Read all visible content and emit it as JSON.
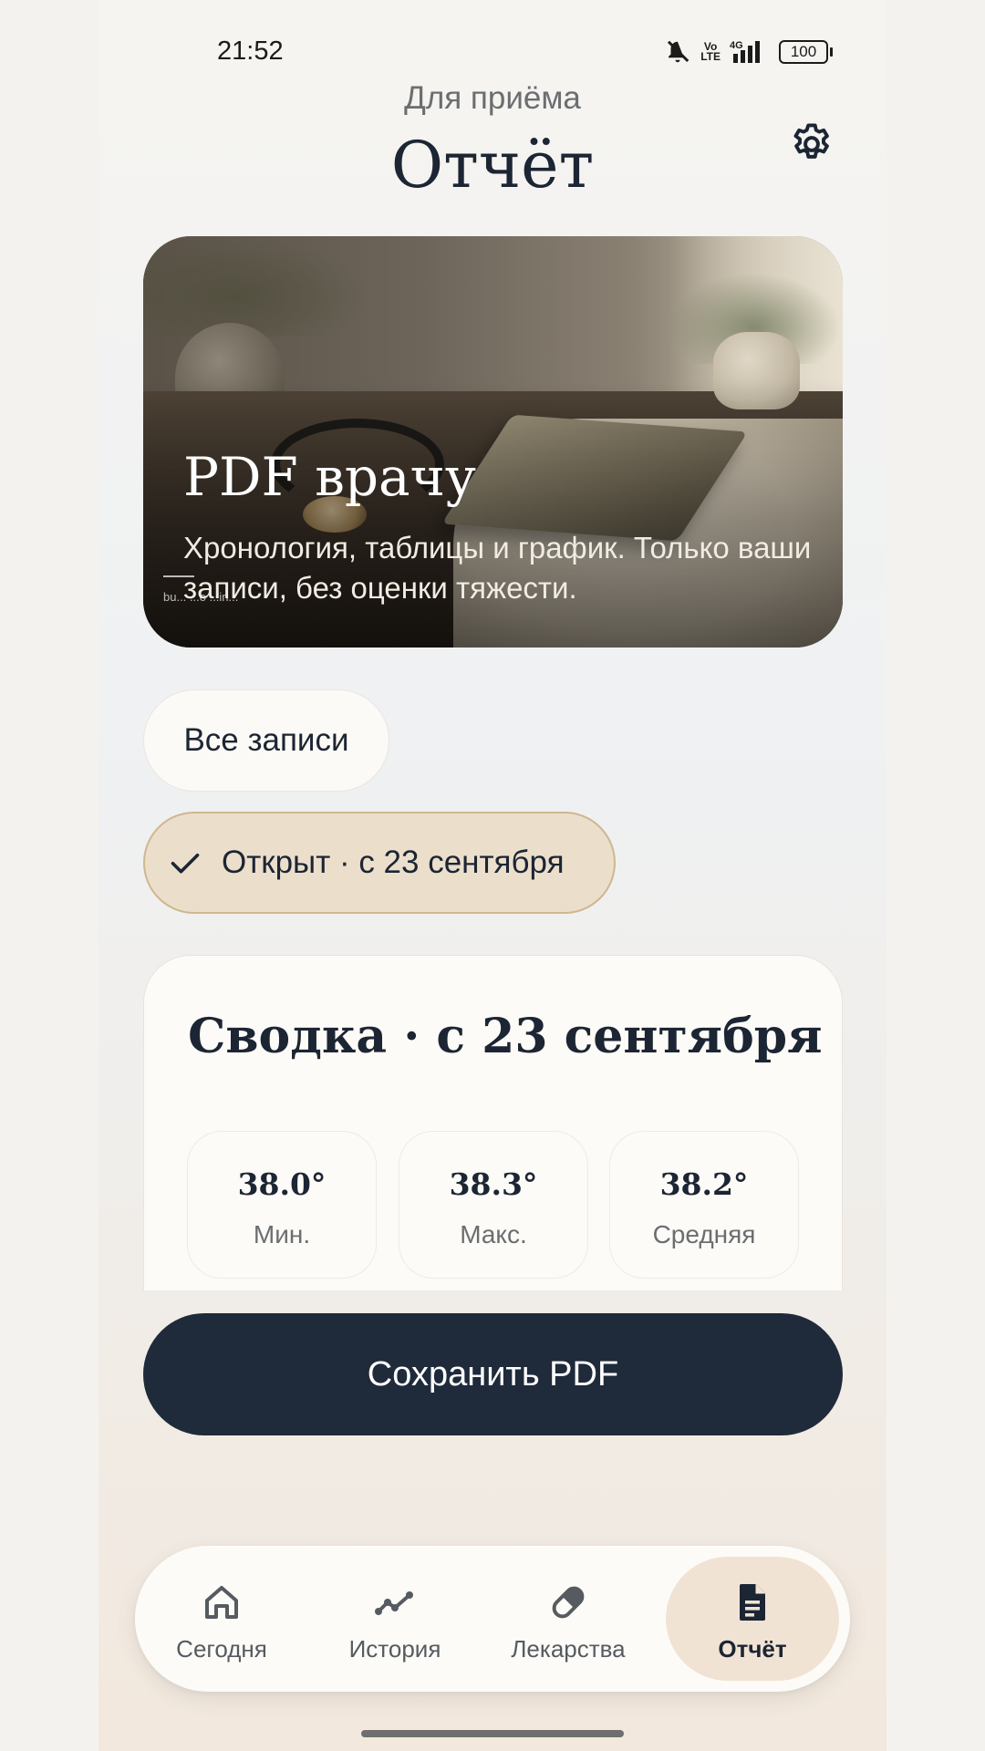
{
  "status_bar": {
    "time": "21:52",
    "volte": "Vo\nLTE",
    "network": "4G",
    "battery": "100"
  },
  "header": {
    "subtitle": "Для приёма",
    "title": "Отчёт"
  },
  "hero": {
    "title": "PDF врачу",
    "description": "Хронология, таблицы и график. Только ваши записи, без оценки тяжести.",
    "credit": "bu... ...o ...in..."
  },
  "filters": {
    "all_label": "Все записи",
    "selected_label": "Открыт · с 23 сентября"
  },
  "summary": {
    "title": "Сводка · с 23 сентября",
    "stats": [
      {
        "value": "38.0°",
        "label": "Мин."
      },
      {
        "value": "38.3°",
        "label": "Макс."
      },
      {
        "value": "38.2°",
        "label": "Средняя"
      }
    ]
  },
  "actions": {
    "save_label": "Сохранить PDF"
  },
  "nav": {
    "items": [
      {
        "label": "Сегодня",
        "icon": "home-icon"
      },
      {
        "label": "История",
        "icon": "trend-icon"
      },
      {
        "label": "Лекарства",
        "icon": "pill-icon"
      },
      {
        "label": "Отчёт",
        "icon": "document-icon",
        "active": true
      }
    ]
  },
  "colors": {
    "primary_dark": "#1f2a3a",
    "accent_beige": "#ebdfcc",
    "active_nav": "#f1e3d3"
  }
}
